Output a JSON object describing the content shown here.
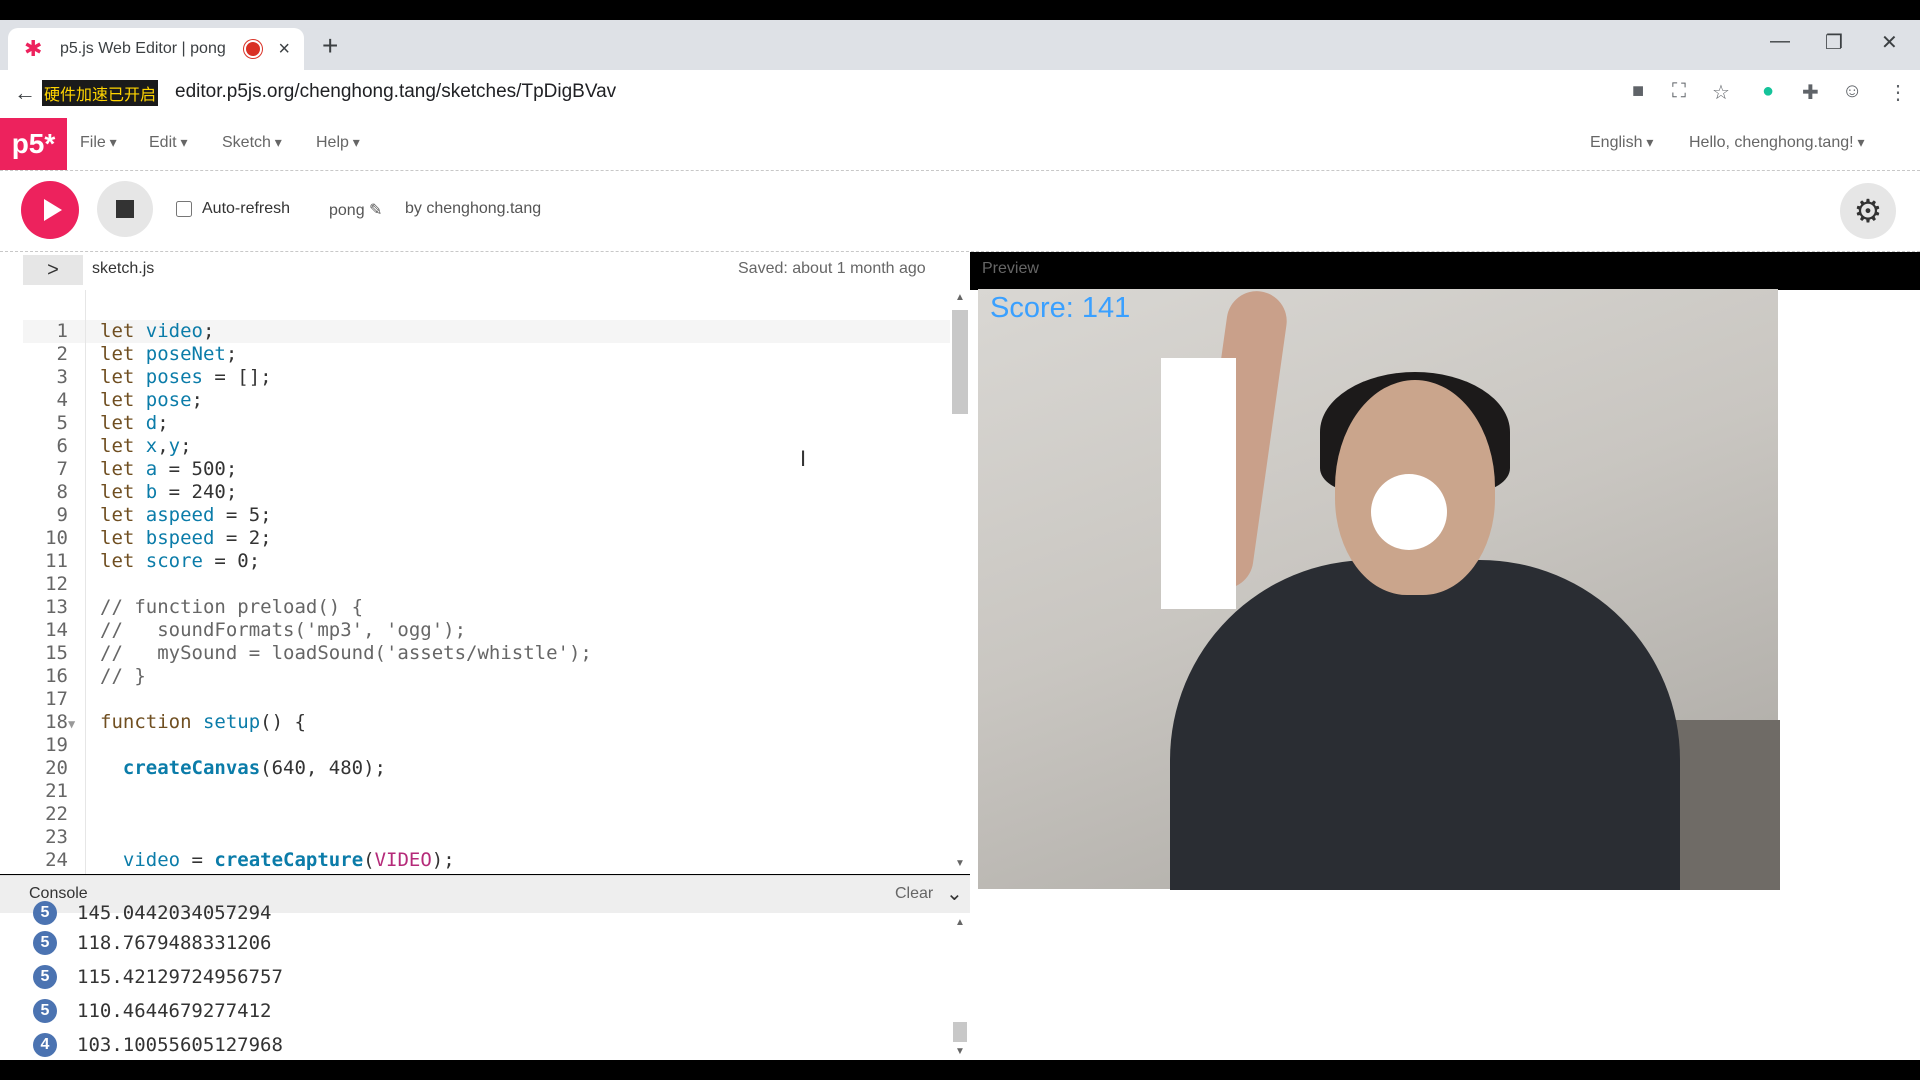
{
  "browser": {
    "tab_title": "p5.js Web Editor | pong",
    "tab_close": "×",
    "new_tab": "+",
    "overlay_text": "硬件加速已开启",
    "url": "editor.p5js.org/chenghong.tang/sketches/TpDigBVav",
    "window_controls": [
      "—",
      "❐",
      "✕"
    ]
  },
  "menubar": {
    "logo": "p5*",
    "items": [
      "File",
      "Edit",
      "Sketch",
      "Help"
    ],
    "language": "English",
    "user": "Hello, chenghong.tang!"
  },
  "toolbar": {
    "auto_refresh_label": "Auto-refresh",
    "sketch_name": "pong ✎",
    "by_line": "by chenghong.tang"
  },
  "editor": {
    "filename": "sketch.js",
    "saved_status": "Saved: about 1 month ago",
    "preview_label": "Preview",
    "lines": [
      [
        [
          "kw",
          "let "
        ],
        [
          "vr",
          "video"
        ],
        [
          "",
          "; "
        ]
      ],
      [
        [
          "kw",
          "let "
        ],
        [
          "vr",
          "poseNet"
        ],
        [
          "",
          ";"
        ]
      ],
      [
        [
          "kw",
          "let "
        ],
        [
          "vr",
          "poses"
        ],
        [
          "",
          " = [];"
        ]
      ],
      [
        [
          "kw",
          "let "
        ],
        [
          "vr",
          "pose"
        ],
        [
          "",
          ";"
        ]
      ],
      [
        [
          "kw",
          "let "
        ],
        [
          "vr",
          "d"
        ],
        [
          "",
          ";"
        ]
      ],
      [
        [
          "kw",
          "let "
        ],
        [
          "vr",
          "x"
        ],
        [
          "",
          ","
        ],
        [
          "vr",
          "y"
        ],
        [
          "",
          ";"
        ]
      ],
      [
        [
          "kw",
          "let "
        ],
        [
          "vr",
          "a"
        ],
        [
          "",
          " = 500;"
        ]
      ],
      [
        [
          "kw",
          "let "
        ],
        [
          "vr",
          "b"
        ],
        [
          "",
          " = 240;"
        ]
      ],
      [
        [
          "kw",
          "let "
        ],
        [
          "vr",
          "aspeed"
        ],
        [
          "",
          " = 5;"
        ]
      ],
      [
        [
          "kw",
          "let "
        ],
        [
          "vr",
          "bspeed"
        ],
        [
          "",
          " = 2;"
        ]
      ],
      [
        [
          "kw",
          "let "
        ],
        [
          "vr",
          "score"
        ],
        [
          "",
          " = 0;"
        ]
      ],
      [
        [
          "",
          ""
        ]
      ],
      [
        [
          "cm",
          "// function preload() {"
        ]
      ],
      [
        [
          "cm",
          "//   soundFormats('mp3', 'ogg');"
        ]
      ],
      [
        [
          "cm",
          "//   mySound = loadSound('assets/whistle');"
        ]
      ],
      [
        [
          "cm",
          "// }"
        ]
      ],
      [
        [
          "",
          ""
        ]
      ],
      [
        [
          "kw",
          "function "
        ],
        [
          "vr",
          "setup"
        ],
        [
          "",
          "() {"
        ]
      ],
      [
        [
          "",
          ""
        ]
      ],
      [
        [
          "",
          "  "
        ],
        [
          "fn",
          "createCanvas"
        ],
        [
          "",
          "(640, 480);"
        ]
      ],
      [
        [
          "",
          ""
        ]
      ],
      [
        [
          "",
          ""
        ]
      ],
      [
        [
          "",
          ""
        ]
      ],
      [
        [
          "",
          "  "
        ],
        [
          "vr",
          "video"
        ],
        [
          "",
          " = "
        ],
        [
          "fn",
          "createCapture"
        ],
        [
          "",
          "("
        ],
        [
          "cs",
          "VIDEO"
        ],
        [
          "",
          ");"
        ]
      ]
    ]
  },
  "console": {
    "label": "Console",
    "clear_label": "Clear",
    "entries": [
      {
        "count": "5",
        "value": "118.7679488331206"
      },
      {
        "count": "5",
        "value": "115.42129724956757"
      },
      {
        "count": "5",
        "value": "110.4644679277412"
      },
      {
        "count": "4",
        "value": "103.10055605127968"
      }
    ],
    "partial_entry": "145.0442034057294"
  },
  "preview": {
    "score_text": "Score: 141"
  }
}
